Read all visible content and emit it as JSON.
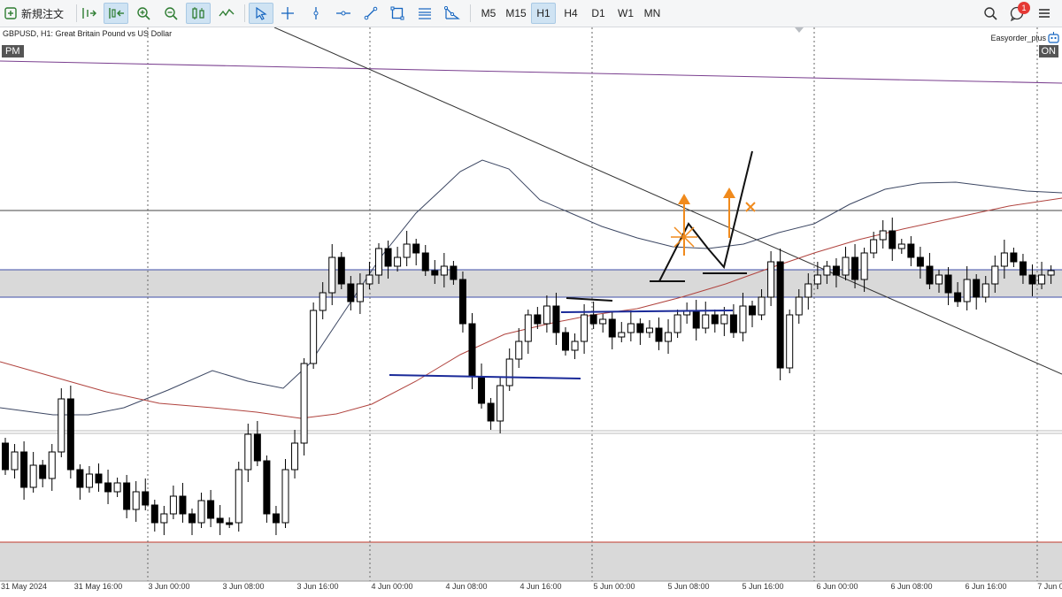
{
  "toolbar": {
    "new_order_label": "新規注文",
    "timeframes": [
      "M5",
      "M15",
      "H1",
      "H4",
      "D1",
      "W1",
      "MN"
    ],
    "active_timeframe": "H1",
    "notification_count": "1"
  },
  "chart": {
    "symbol_label": "GBPUSD, H1:  Great Britain Pound vs US Dollar",
    "pm_badge": "PM",
    "ea_label": "Easyorder_plus",
    "ea_status": "ON",
    "x_ticks": [
      "31 May 2024",
      "31 May 16:00",
      "3 Jun 00:00",
      "3 Jun 08:00",
      "3 Jun 16:00",
      "4 Jun 00:00",
      "4 Jun 08:00",
      "4 Jun 16:00",
      "5 Jun 00:00",
      "5 Jun 08:00",
      "5 Jun 16:00",
      "6 Jun 00:00",
      "6 Jun 08:00",
      "6 Jun 16:00",
      "7 Jun 0"
    ]
  },
  "colors": {
    "bull_candle": "#ffffff",
    "bear_candle": "#000000",
    "zone_fill": "#d9d9d9",
    "zone_border": "#3f4fa8",
    "ma_fast": "#3c4763",
    "ma_slow": "#b0433e",
    "drawing_blue": "#1a2a99",
    "drawing_orange": "#f08a1c"
  }
}
